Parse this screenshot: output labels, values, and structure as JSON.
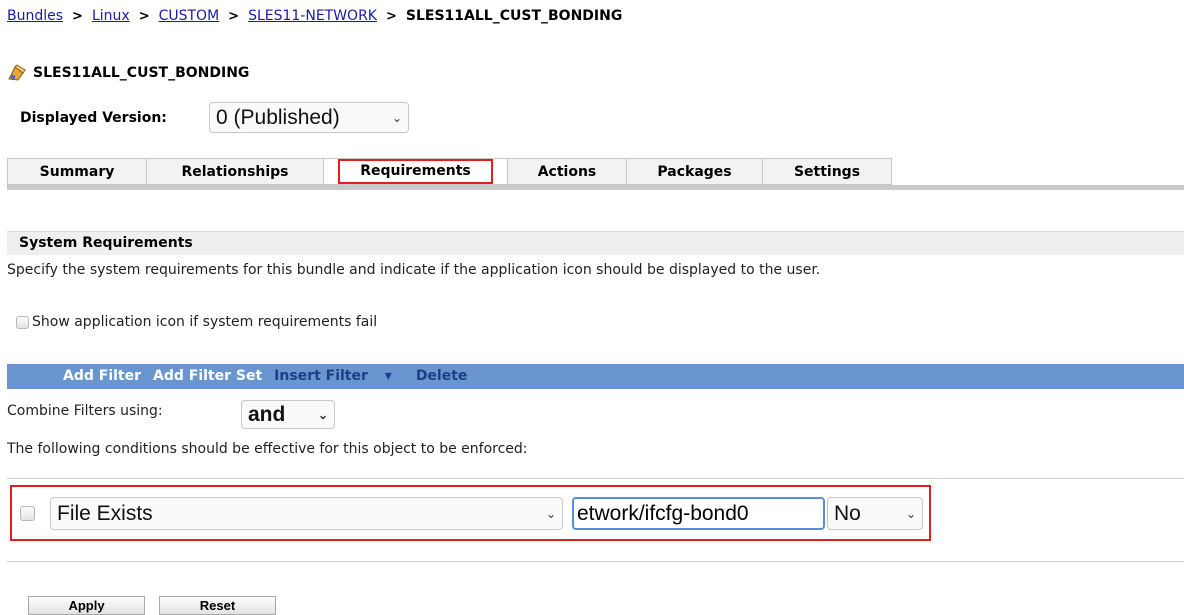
{
  "breadcrumb": {
    "items": [
      "Bundles",
      "Linux",
      "CUSTOM",
      "SLES11-NETWORK"
    ],
    "current": "SLES11ALL_CUST_BONDING",
    "separator": ">"
  },
  "page": {
    "title": "SLES11ALL_CUST_BONDING",
    "icon": "bundle-icon"
  },
  "version": {
    "label": "Displayed Version:",
    "selected": "0 (Published)"
  },
  "tabs": [
    {
      "label": "Summary",
      "active": false
    },
    {
      "label": "Relationships",
      "active": false
    },
    {
      "label": "Requirements",
      "active": true
    },
    {
      "label": "Actions",
      "active": false
    },
    {
      "label": "Packages",
      "active": false
    },
    {
      "label": "Settings",
      "active": false
    }
  ],
  "section": {
    "title": "System Requirements",
    "description": "Specify the system requirements for this bundle and indicate if the application icon should be displayed to the user.",
    "show_icon_label": "Show application icon if system requirements fail",
    "show_icon_checked": false
  },
  "toolbar": {
    "add_filter": "Add Filter",
    "add_filter_set": "Add Filter Set",
    "insert_filter": "Insert Filter",
    "delete": "Delete",
    "bar_color": "#6a96cf"
  },
  "combine": {
    "label": "Combine Filters using:",
    "selected": "and"
  },
  "conditions_label": "The following conditions should be effective for this object to be enforced:",
  "filter": {
    "checked": false,
    "condition_type": "File Exists",
    "path_value": "etwork/ifcfg-bond0",
    "operator": "No"
  },
  "buttons": {
    "apply": "Apply",
    "reset": "Reset"
  },
  "colors": {
    "highlight": "#e02020",
    "link": "#1a1aa6"
  }
}
